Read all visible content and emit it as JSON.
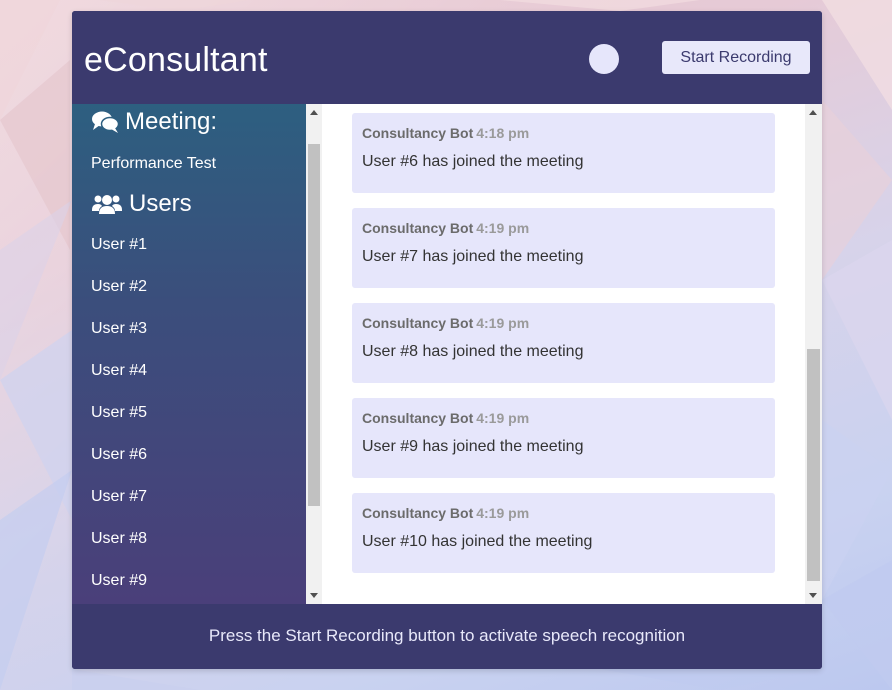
{
  "header": {
    "app_title": "eConsultant",
    "record_button_label": "Start Recording"
  },
  "sidebar": {
    "meeting_heading": "Meeting:",
    "meeting_name": "Performance Test",
    "users_heading": "Users",
    "users": [
      "User #1",
      "User #2",
      "User #3",
      "User #4",
      "User #5",
      "User #6",
      "User #7",
      "User #8",
      "User #9"
    ]
  },
  "chat": {
    "messages": [
      {
        "sender": "Consultancy Bot",
        "time": "4:18 pm",
        "text": "User #6 has joined the meeting"
      },
      {
        "sender": "Consultancy Bot",
        "time": "4:19 pm",
        "text": "User #7 has joined the meeting"
      },
      {
        "sender": "Consultancy Bot",
        "time": "4:19 pm",
        "text": "User #8 has joined the meeting"
      },
      {
        "sender": "Consultancy Bot",
        "time": "4:19 pm",
        "text": "User #9 has joined the meeting"
      },
      {
        "sender": "Consultancy Bot",
        "time": "4:19 pm",
        "text": "User #10 has joined the meeting"
      }
    ]
  },
  "footer": {
    "status_text": "Press the Start Recording button to activate speech recognition"
  },
  "icons": {
    "meeting": "comments-icon",
    "users": "users-icon"
  },
  "colors": {
    "primary": "#3b3a6e",
    "message_bg": "#e6e6fb",
    "accent_light": "#e8e8fa"
  }
}
